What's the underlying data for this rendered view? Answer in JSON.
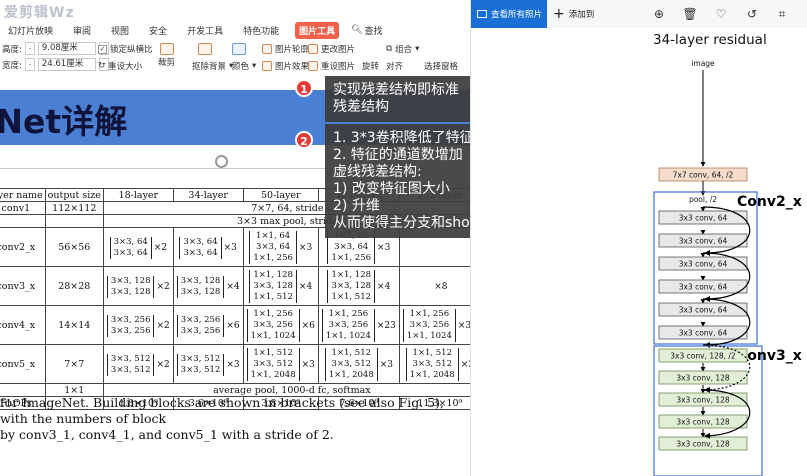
{
  "app": {
    "title_ghost": "爱剪辑Wz",
    "tabs": [
      "幻灯片放映",
      "审阅",
      "视图",
      "安全",
      "开发工具",
      "特色功能",
      "图片工具"
    ],
    "search_label": "查找"
  },
  "ribbon": {
    "height_label": "高度:",
    "height_value": "9.08厘米",
    "width_label": "宽度:",
    "width_value": "24.61厘米",
    "lock_ratio": "锁定纵横比",
    "reset_size": "重设大小",
    "crop": "裁剪",
    "remove_bg": "抠除背景",
    "color": "颜色",
    "picture_outline": "图片轮廓",
    "picture_effect": "图片效果",
    "change_picture": "更改图片",
    "reset_picture": "重设图片",
    "rotate": "旋转",
    "group": "组合",
    "align": "对齐",
    "selection_pane": "选择窗格"
  },
  "slide": {
    "title": "ResNet详解",
    "table": {
      "headers": [
        "layer name",
        "output size",
        "18-layer",
        "34-layer",
        "50-layer",
        "101-layer",
        "152-layer"
      ],
      "rows": [
        {
          "name": "conv1",
          "size": "112×112",
          "merged": "7×7, 64, stride 2"
        },
        {
          "name": "",
          "size": "",
          "merged": "3×3 max pool, stride 2"
        },
        {
          "name": "conv2_x",
          "size": "56×56",
          "c18": [
            "3×3, 64",
            "3×3, 64"
          ],
          "m18": "×2",
          "c34": [
            "3×3, 64",
            "3×3, 64"
          ],
          "m34": "×3",
          "c50": [
            "1×1, 64",
            "3×3, 64",
            "1×1, 256"
          ],
          "m50": "×3",
          "c101": [
            "1×1, 64",
            "3×3, 64",
            "1×1, 256"
          ],
          "m101": "×3"
        },
        {
          "name": "conv3_x",
          "size": "28×28",
          "c18": [
            "3×3, 128",
            "3×3, 128"
          ],
          "m18": "×2",
          "c34": [
            "3×3, 128",
            "3×3, 128"
          ],
          "m34": "×4",
          "c50": [
            "1×1, 128",
            "3×3, 128",
            "1×1, 512"
          ],
          "m50": "×4",
          "c101": [
            "1×1, 128",
            "3×3, 128",
            "1×1, 512"
          ],
          "m101": "×4",
          "m152": "×8"
        },
        {
          "name": "conv4_x",
          "size": "14×14",
          "c18": [
            "3×3, 256",
            "3×3, 256"
          ],
          "m18": "×2",
          "c34": [
            "3×3, 256",
            "3×3, 256"
          ],
          "m34": "×6",
          "c50": [
            "1×1, 256",
            "3×3, 256",
            "1×1, 1024"
          ],
          "m50": "×6",
          "c101": [
            "1×1, 256",
            "3×3, 256",
            "1×1, 1024"
          ],
          "m101": "×23",
          "c152": [
            "1×1, 256",
            "3×3, 256",
            "1×1, 1024"
          ],
          "m152": "×36"
        },
        {
          "name": "conv5_x",
          "size": "7×7",
          "c18": [
            "3×3, 512",
            "3×3, 512"
          ],
          "m18": "×2",
          "c34": [
            "3×3, 512",
            "3×3, 512"
          ],
          "m34": "×3",
          "c50": [
            "1×1, 512",
            "3×3, 512",
            "1×1, 2048"
          ],
          "m50": "×3",
          "c101": [
            "1×1, 512",
            "3×3, 512",
            "1×1, 2048"
          ],
          "m101": "×3",
          "c152": [
            "1×1, 512",
            "3×3, 512",
            "1×1, 2048"
          ],
          "m152": "×3"
        },
        {
          "name": "",
          "size": "1×1",
          "merged": "average pool, 1000-d fc, softmax"
        },
        {
          "name": "FLOPs",
          "size": "",
          "f18": "1.8×10⁹",
          "f34": "3.6×10⁹",
          "f50": "3.8×10⁹",
          "f101": "7.6×10⁹",
          "f152": "11.3×10⁹"
        }
      ]
    },
    "caption_line1": "for ImageNet. Building blocks are shown in brackets (see also Fig. 5), with the numbers of block",
    "caption_line2": "by conv3_1, conv4_1, and conv5_1 with a stride of 2."
  },
  "notes": {
    "badge1": "1",
    "note1": "实现残差结构即标准残差结构",
    "badge2": "2",
    "note2_lines": [
      "1. 3*3卷积降低了特征图的大小",
      "2. 特征的通道数增加",
      "虚线残差结构:",
      "1) 改变特征图大小",
      "2) 升维",
      "从而使得主分支和shortcut的shape相同"
    ]
  },
  "viewer": {
    "view_all": "查看所有照片",
    "add_to": "添加到",
    "icons": [
      "zoom-in-icon",
      "trash-icon",
      "heart-icon",
      "rotate-icon",
      "crop-icon"
    ],
    "arch_title": "34-layer residual",
    "input_label": "image",
    "conv1_label": "7x7 conv, 64, /2",
    "pool_label": "pool, /2",
    "conv2_label": "Conv2_x",
    "conv2_blocks": [
      "3x3 conv, 64",
      "3x3 conv, 64",
      "3x3 conv, 64",
      "3x3 conv, 64",
      "3x3 conv, 64",
      "3x3 conv, 64"
    ],
    "conv3_label": "Conv3_x",
    "conv3_blocks": [
      "3x3 conv, 128, /2",
      "3x3 conv, 128",
      "3x3 conv, 128",
      "3x3 conv, 128",
      "3x3 conv, 128"
    ]
  }
}
